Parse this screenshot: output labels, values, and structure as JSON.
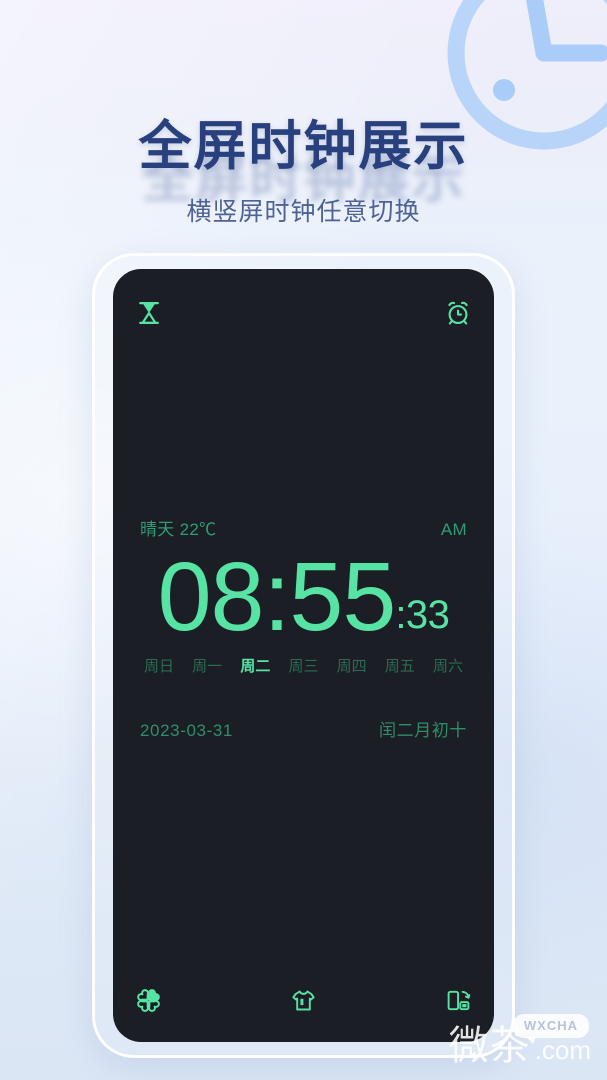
{
  "promo": {
    "title": "全屏时钟展示",
    "subtitle": "横竖屏时钟任意切换",
    "title_color": "#28407d",
    "subtitle_color": "#4e6296",
    "background_colors": [
      "#efeefb",
      "#e9f1fb",
      "#dbe6f5"
    ]
  },
  "decor": {
    "clock_icon": "clock-outline-icon",
    "clock_color": "#a9cdf8"
  },
  "phone": {
    "screen_bg": "#1b1e24",
    "accent_color": "#56e3a4",
    "dim_accent_color": "#2e9c74",
    "topbar": {
      "left_icon": "hourglass-icon",
      "right_icon": "alarm-clock-icon"
    },
    "clock": {
      "weather": "晴天 22℃",
      "meridiem": "AM",
      "time": "08:55",
      "seconds": ":33",
      "weekdays": [
        {
          "label": "周日",
          "active": false
        },
        {
          "label": "周一",
          "active": false
        },
        {
          "label": "周二",
          "active": true
        },
        {
          "label": "周三",
          "active": false
        },
        {
          "label": "周四",
          "active": false
        },
        {
          "label": "周五",
          "active": false
        },
        {
          "label": "周六",
          "active": false
        }
      ],
      "date": "2023-03-31",
      "lunar_date": "闰二月初十"
    },
    "bottombar": {
      "left_icon": "clover-icon",
      "center_icon": "tshirt-icon",
      "right_icon": "rotate-screen-icon"
    }
  },
  "watermark": {
    "badge": "WXCHA",
    "cn": "微茶",
    "domain": ".com"
  }
}
